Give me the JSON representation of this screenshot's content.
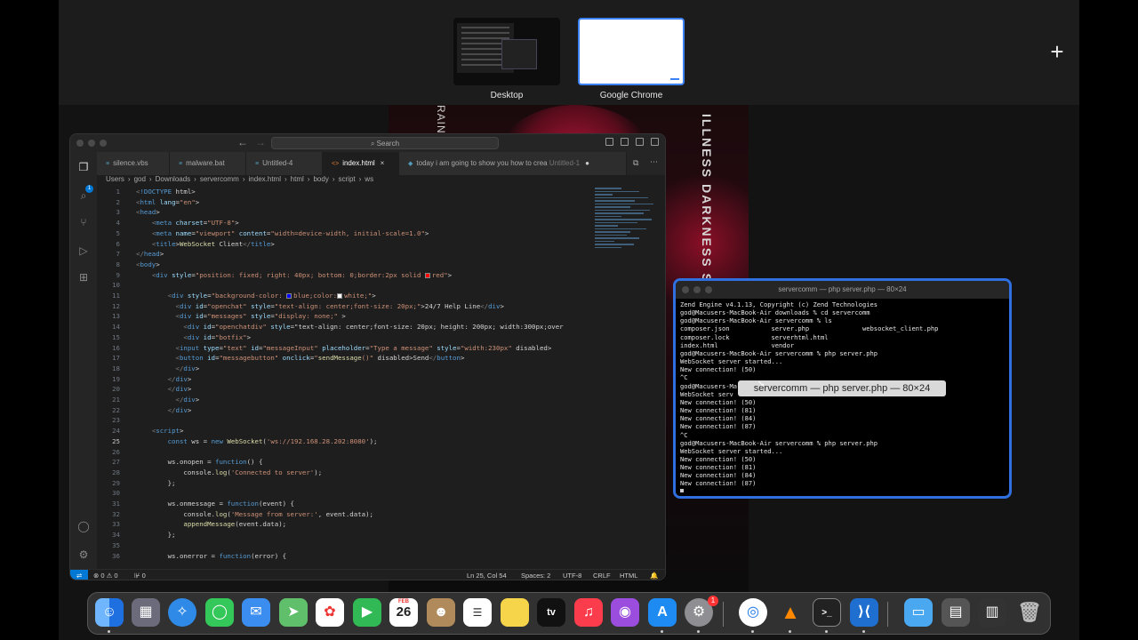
{
  "spaces": {
    "desktop_label": "Desktop",
    "chrome_label": "Google Chrome",
    "add_label": "+"
  },
  "poster": {
    "text_left": "RAINBOW ME",
    "text_right": "ILLNESS DARKNESS Stc FOR"
  },
  "vscode": {
    "search_label": "Search",
    "tabs": [
      {
        "icon": "≡",
        "label": "silence.vbs"
      },
      {
        "icon": "≡",
        "label": "malware.bat"
      },
      {
        "icon": "≡",
        "label": "Untitled-4"
      },
      {
        "icon": "<>",
        "label": "index.html",
        "close": "×"
      },
      {
        "icon": "◆",
        "label": "today i am going to show you how to crea",
        "sub": "Untitled-1",
        "dot": "●"
      }
    ],
    "breadcrumb": [
      "Users",
      "god",
      "Downloads",
      "servercomm",
      "index.html",
      "html",
      "body",
      "script",
      "ws"
    ],
    "status": {
      "errors": "⊗ 0 ⚠ 0",
      "ports": "⊮ 0",
      "position": "Ln 25, Col 54",
      "spaces": "Spaces: 2",
      "encoding": "UTF-8",
      "eol": "CRLF",
      "language": "HTML",
      "bell": "🔔"
    },
    "line_numbers": [
      "1",
      "2",
      "3",
      "4",
      "5",
      "6",
      "7",
      "8",
      "9",
      "10",
      "11",
      "12",
      "13",
      "14",
      "15",
      "16",
      "17",
      "18",
      "19",
      "20",
      "21",
      "22",
      "23",
      "24",
      "25",
      "26",
      "27",
      "28",
      "29",
      "30",
      "31",
      "32",
      "33",
      "34",
      "35",
      "36"
    ],
    "lines": [
      "<!DOCTYPE html>",
      "<html lang=\"en\">",
      "<head>",
      "    <meta charset=\"UTF-8\">",
      "    <meta name=\"viewport\" content=\"width=device-width, initial-scale=1.0\">",
      "    <title>WebSocket Client</title>",
      "</head>",
      "<body>",
      "    <div style=\"position: fixed; right: 40px; bottom: 0;border:2px solid ■red\">",
      "",
      "        <div style=\"background-color: ■blue;color:■white;\">",
      "          <div id=\"openchat\" style=\"text-align: center;font-size: 20px;\">24/7 Help Line</div>",
      "          <div id=\"messages\" style=\"display: none;\" >",
      "            <div id=\"openchatdiv\" style=\"text-align: center;font-size: 20px; height: 200px; width:300px;over",
      "            <div id=\"botfix\">",
      "          <input type=\"text\" id=\"messageInput\" placeholder=\"Type a message\" style=\"width:230px\" disabled>",
      "          <button id=\"messagebutton\" onclick=\"sendMessage()\" disabled>Send</button>",
      "          </div>",
      "        </div>",
      "        </div>",
      "          </div>",
      "        </div>",
      "",
      "    <script>",
      "        const ws = new WebSocket('ws://192.168.28.202:8080');",
      "",
      "        ws.onopen = function() {",
      "            console.log('Connected to server');",
      "        };",
      "",
      "        ws.onmessage = function(event) {",
      "            console.log('Message from server:', event.data);",
      "            appendMessage(event.data);",
      "        };",
      "",
      "        ws.onerror = function(error) {"
    ]
  },
  "terminal": {
    "title": "servercomm — php server.php — 80×24",
    "tooltip": "servercomm — php server.php — 80×24",
    "lines": [
      "Zend Engine v4.1.13, Copyright (c) Zend Technologies",
      "god@Macusers-MacBook-Air downloads % cd servercomm",
      "god@Macusers-MacBook-Air servercomm % ls",
      "composer.json           server.php              websocket_client.php",
      "composer.lock           serverhtml.html",
      "index.html              vendor",
      "god@Macusers-MacBook-Air servercomm % php server.php",
      "WebSocket server started...",
      "New connection! (50)",
      "^C",
      "god@Macusers-Ma",
      "WebSocket serv",
      "New connection! (50)",
      "New connection! (81)",
      "New connection! (84)",
      "New connection! (87)",
      "^C",
      "god@Macusers-MacBook-Air servercomm % php server.php",
      "WebSocket server started...",
      "New connection! (50)",
      "New connection! (81)",
      "New connection! (84)",
      "New connection! (87)"
    ]
  },
  "dock": {
    "calendar_month": "FEB",
    "calendar_day": "26",
    "settings_badge": "1",
    "tv_label": "tv",
    "terminal_label": ">_",
    "items": [
      "Finder",
      "Launchpad",
      "Safari",
      "Messages",
      "Mail",
      "Maps",
      "Photos",
      "FaceTime",
      "Calendar",
      "Contacts",
      "Reminders",
      "Notes",
      "TV",
      "Music",
      "Podcasts",
      "App Store",
      "System Settings",
      "Google Chrome",
      "VLC",
      "Terminal",
      "Visual Studio Code",
      "Downloads",
      "Folder",
      "Stack",
      "Trash"
    ]
  },
  "colors": {
    "accent": "#2f6fe0",
    "vscode_bg": "#1e1e1e",
    "status_blue": "#0078d4"
  }
}
